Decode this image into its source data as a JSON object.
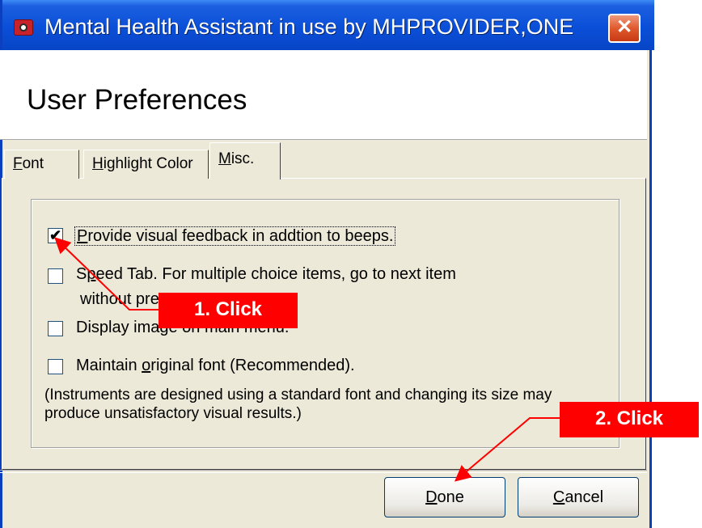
{
  "window": {
    "title": "Mental Health Assistant in use by MHPROVIDER,ONE",
    "close_label": "✕",
    "icon": "app-icon"
  },
  "header": {
    "title": "User Preferences"
  },
  "tabs": [
    {
      "label_pre": "",
      "label_key": "F",
      "label_post": "ont",
      "active": false
    },
    {
      "label_pre": "",
      "label_key": "H",
      "label_post": "ighlight Color",
      "active": false
    },
    {
      "label_pre": "",
      "label_key": "M",
      "label_post": "isc.",
      "active": true
    }
  ],
  "options": [
    {
      "pre": "",
      "key": "P",
      "post": "rovide visual feedback in addtion to beeps.",
      "checked": true,
      "check_glyph": "✔"
    },
    {
      "pre": "S",
      "key": "p",
      "post": "eed Tab. For multiple choice items, go to next item",
      "line2": "without pre",
      "checked": false
    },
    {
      "pre": "Display ima",
      "key": "g",
      "post": "e on main menu.",
      "checked": false
    },
    {
      "pre": "Maintain ",
      "key": "o",
      "post": "riginal font (Recommended).",
      "checked": false
    }
  ],
  "note": "(Instruments are designed using a standard font and changing its size may produce unsatisfactory visual results.)",
  "buttons": {
    "done_key": "D",
    "done_rest": "one",
    "cancel_key": "C",
    "cancel_rest": "ancel"
  },
  "annotations": {
    "callout1": "1. Click",
    "callout2": "2. Click",
    "color": "#ff0000"
  }
}
